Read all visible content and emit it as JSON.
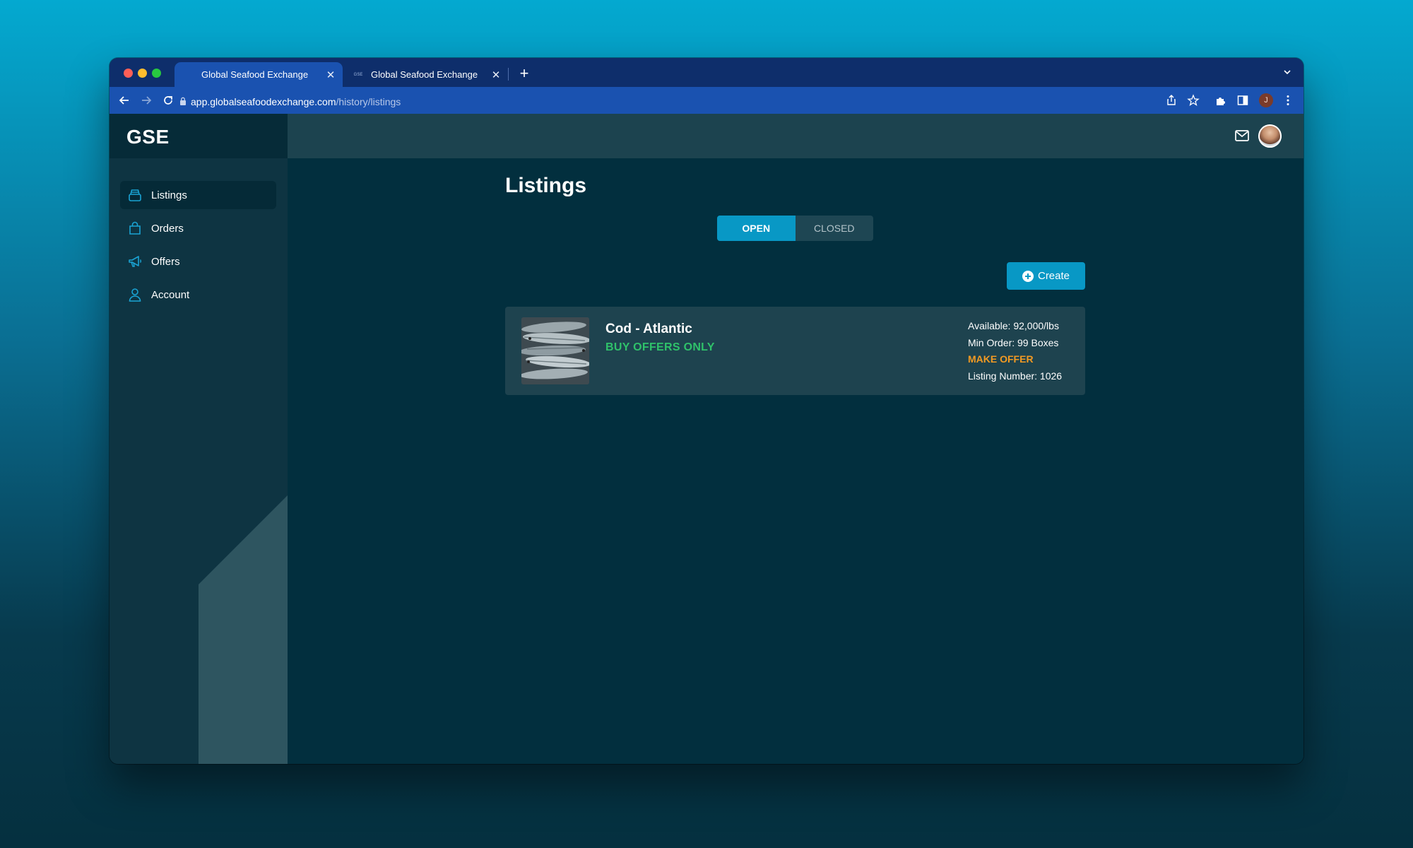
{
  "browser": {
    "tabs": [
      {
        "title": "Global Seafood Exchange",
        "active": true
      },
      {
        "title": "Global Seafood Exchange",
        "active": false,
        "favicon_text": "GSE"
      }
    ],
    "url_host": "app.globalseafoodexchange.com",
    "url_path": "/history/listings",
    "profile_initial": "J"
  },
  "app": {
    "logo": "GSE",
    "sidebar": {
      "items": [
        {
          "label": "Listings",
          "icon": "inbox-tray-icon",
          "active": true
        },
        {
          "label": "Orders",
          "icon": "shopping-bag-icon",
          "active": false
        },
        {
          "label": "Offers",
          "icon": "megaphone-icon",
          "active": false
        },
        {
          "label": "Account",
          "icon": "user-icon",
          "active": false
        }
      ]
    },
    "topbar": {
      "icons": [
        "mail-icon",
        "avatar"
      ]
    },
    "main": {
      "title": "Listings",
      "toggle": {
        "options": [
          "OPEN",
          "CLOSED"
        ],
        "selected": "OPEN"
      },
      "create_label": "Create",
      "listings": [
        {
          "name": "Cod - Atlantic",
          "mode": "BUY OFFERS ONLY",
          "available": "Available: 92,000/lbs",
          "min_order": "Min Order: 99 Boxes",
          "action": "MAKE OFFER",
          "listing_number": "Listing Number: 1026"
        }
      ]
    }
  },
  "colors": {
    "accent": "#0898c5",
    "success": "#2fc26a",
    "warning": "#f29a23",
    "background": "#022f3e"
  }
}
